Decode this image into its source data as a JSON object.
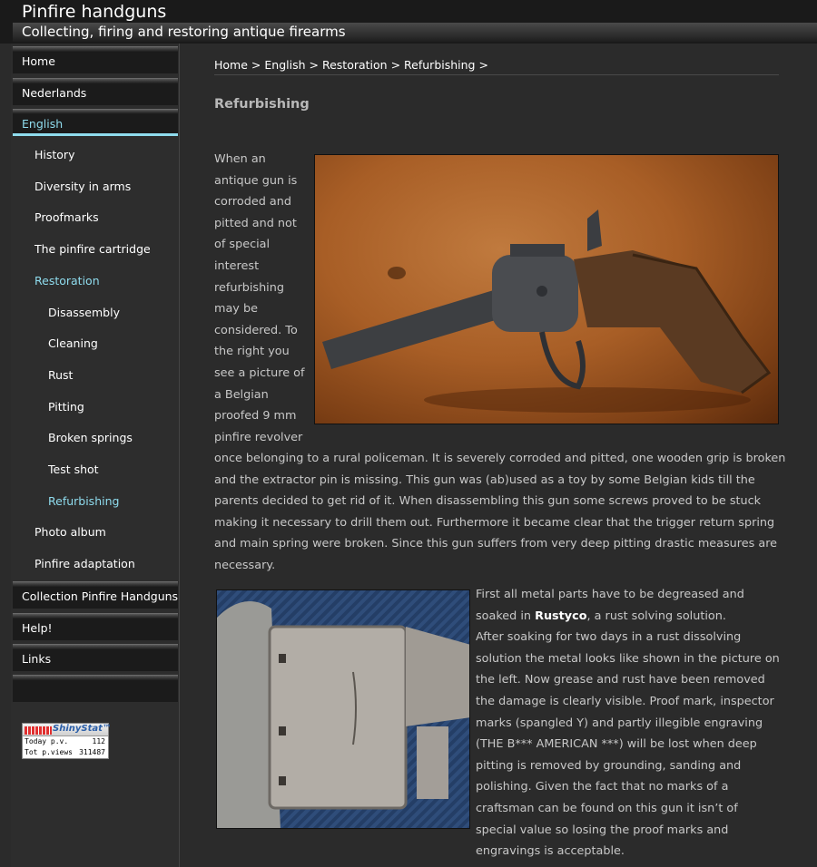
{
  "header": {
    "title": "Pinfire handguns",
    "subtitle": "Collecting, firing and restoring antique firearms"
  },
  "sidebar": {
    "top_items": [
      {
        "label": "Home"
      },
      {
        "label": "Nederlands"
      },
      {
        "label": "English",
        "active": true
      },
      {
        "label": "Collection Pinfire Handguns"
      },
      {
        "label": "Help!"
      },
      {
        "label": "Links"
      }
    ],
    "sub_items": [
      {
        "label": "History"
      },
      {
        "label": "Diversity in arms"
      },
      {
        "label": "Proofmarks"
      },
      {
        "label": "The pinfire cartridge"
      },
      {
        "label": "Restoration",
        "active": true
      },
      {
        "label": "Disassembly"
      },
      {
        "label": "Cleaning"
      },
      {
        "label": "Rust"
      },
      {
        "label": "Pitting"
      },
      {
        "label": "Broken springs"
      },
      {
        "label": "Test shot"
      },
      {
        "label": "Refurbishing",
        "active": true
      },
      {
        "label": "Photo album"
      },
      {
        "label": "Pinfire adaptation"
      }
    ],
    "stat_widget": {
      "brand": "ShinyStat™",
      "today_label": "Today p.v.",
      "today_value": "112",
      "total_label": "Tot p.views",
      "total_value": "311487"
    }
  },
  "breadcrumb": [
    "Home",
    "English",
    "Restoration",
    "Refurbishing"
  ],
  "breadcrumb_sep": ">",
  "page_title": "Refurbishing",
  "text": {
    "intro_lines": [
      "When an",
      "antique gun is",
      "corroded and",
      "pitted and not",
      "of special",
      "interest",
      "refurbishing",
      "may be",
      "considered. To",
      "the right you",
      "see a picture of",
      "a Belgian",
      "proofed 9 mm",
      "pinfire revolver"
    ],
    "intro_full_lines": [
      "once belonging to a rural policeman. It is severely corroded and pitted, one wooden grip is broken",
      "and the extractor pin is missing. This gun was (ab)used as a toy by some Belgian kids till the",
      "parents decided to get rid of it. When disassembling this gun some screws proved to be stuck",
      "making it necessary to drill them out. Furthermore it became clear that the trigger return spring",
      "and main spring were broken. Since this gun suffers from very deep pitting drastic measures are",
      "necessary."
    ],
    "p2_line1": "First all metal parts have to be degreased and",
    "p2_line2_a": "soaked in ",
    "p2_bold": "Rustyco",
    "p2_line2_b": ", a rust solving solution.",
    "p2_rest": [
      "After soaking for two days in a rust dissolving",
      "solution the metal looks like shown in the picture on",
      "the left. Now grease and rust have been removed",
      "the damage is clearly visible. Proof mark, inspector",
      "marks (spangled Y) and partly illegible engraving",
      "(THE B*** AMERICAN ***) will be lost when deep",
      "pitting is removed by grounding, sanding and",
      "polishing. Given the fact that no marks of a",
      "craftsman can be found on this gun it isn’t of",
      "special value so losing the proof marks and",
      "engravings is acceptable."
    ]
  },
  "colors": {
    "accent": "#8fdcee",
    "background": "#2b2b2b",
    "text": "#c8c8c8"
  }
}
